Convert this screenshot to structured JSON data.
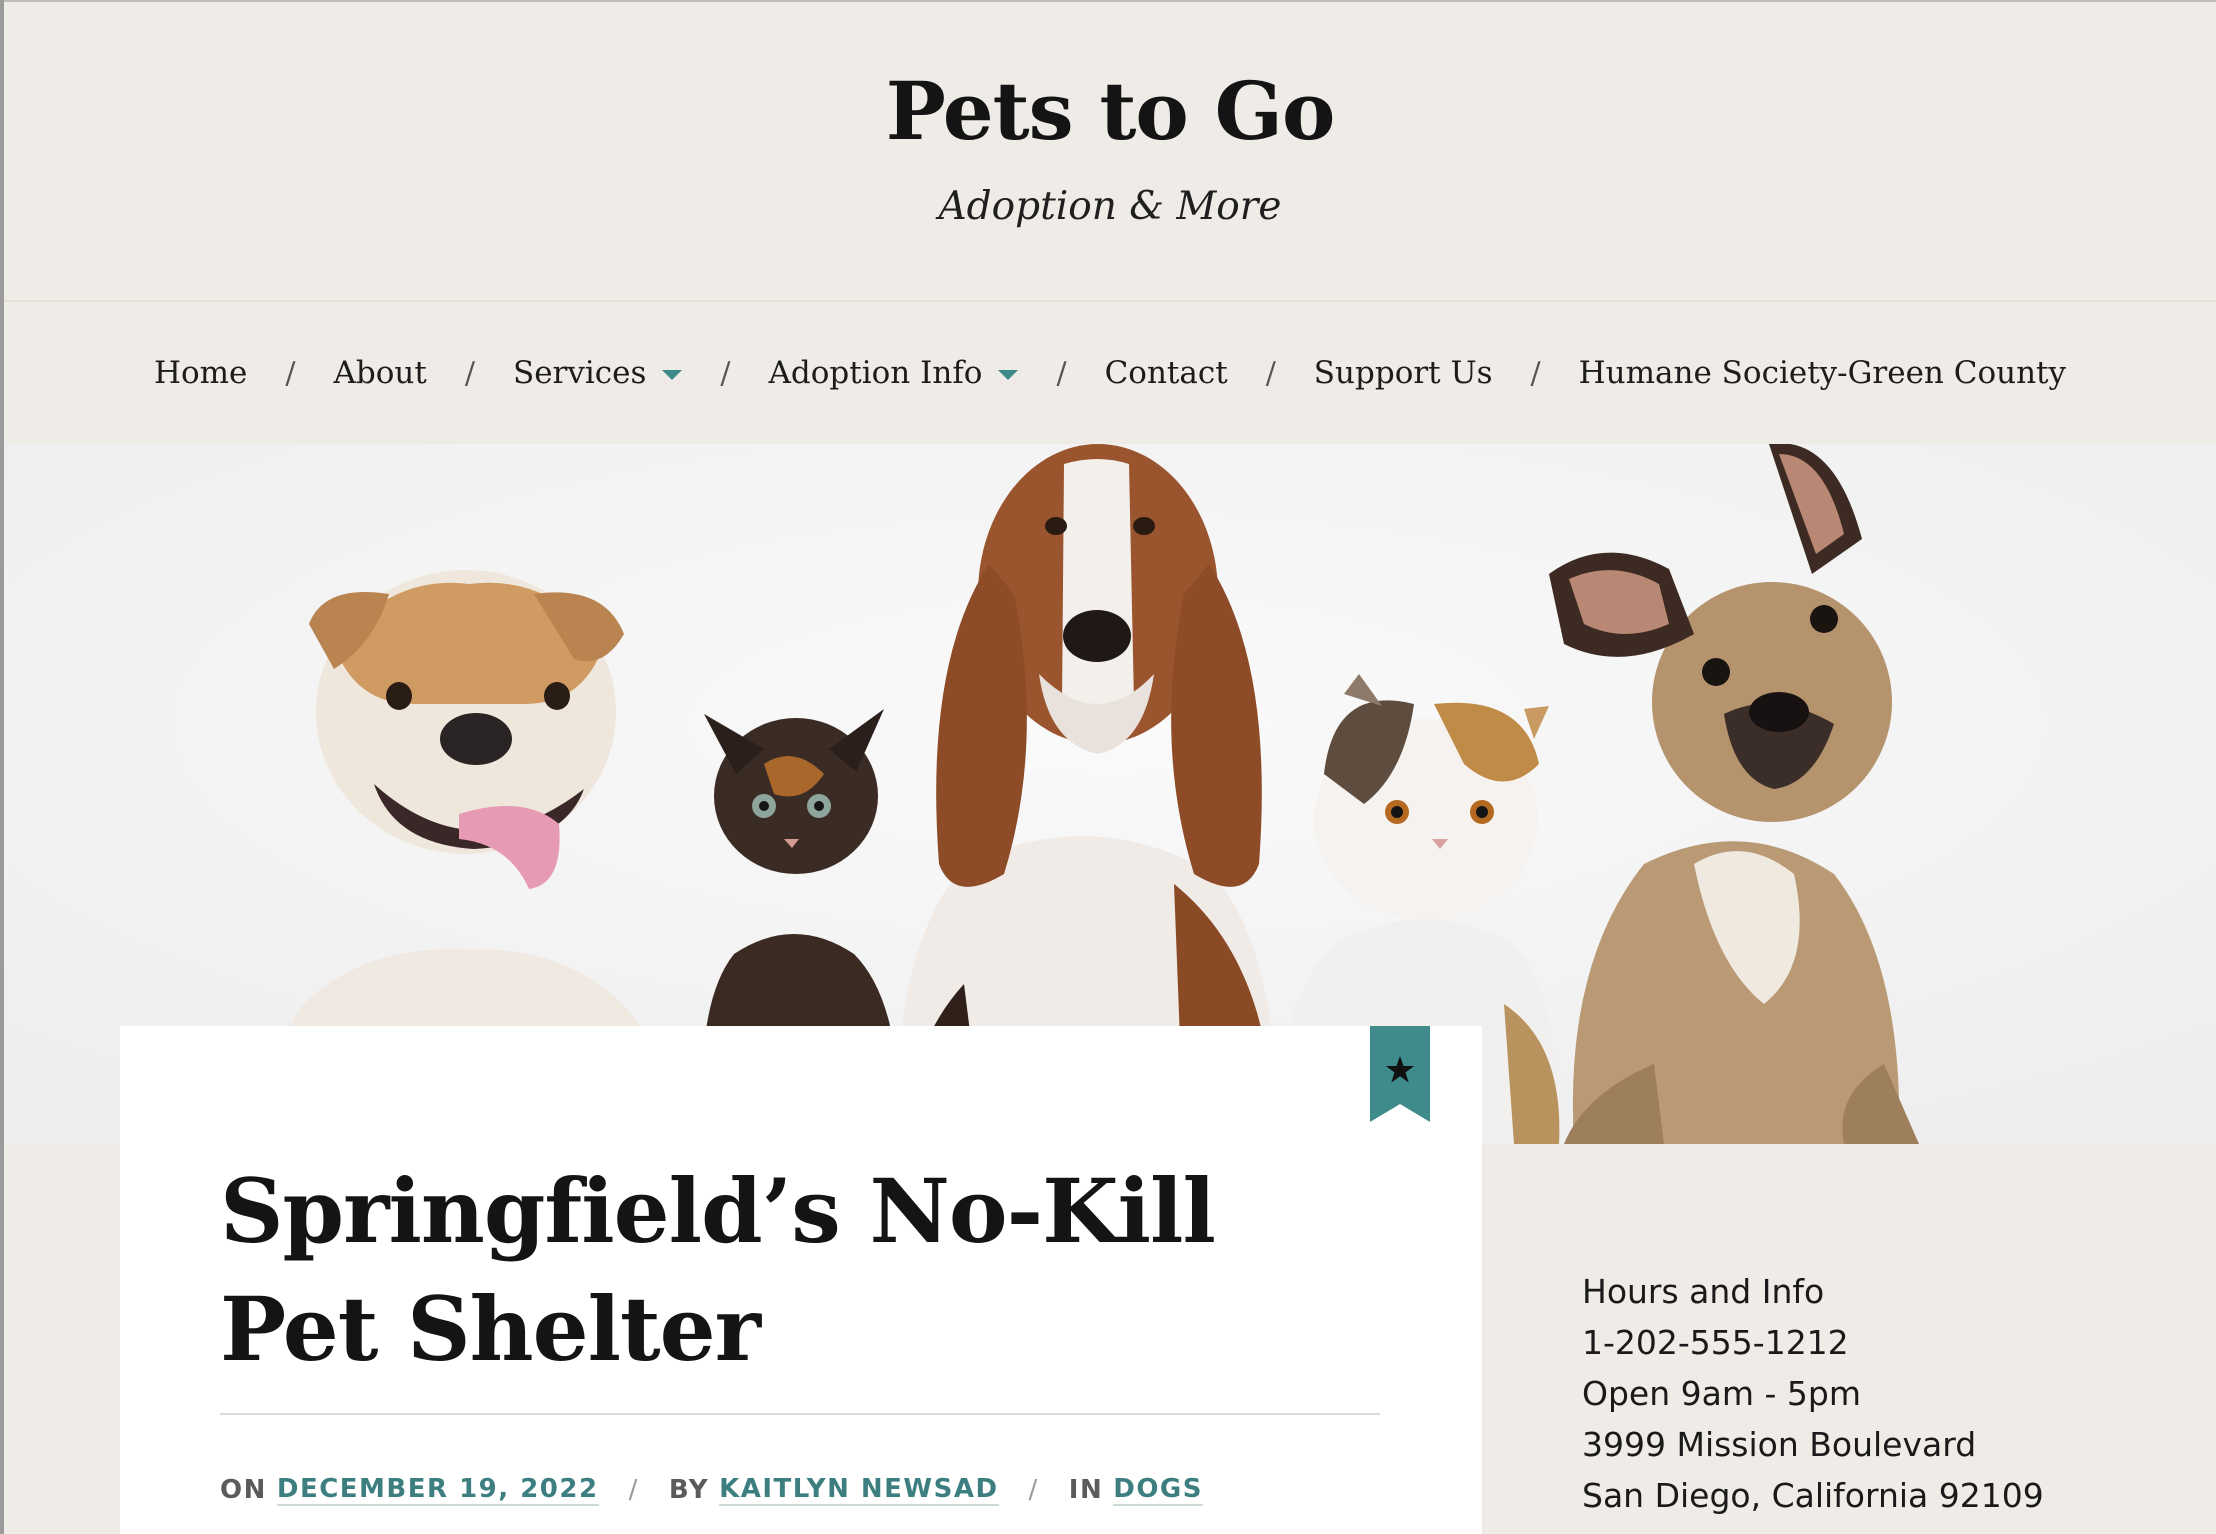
{
  "site": {
    "title": "Pets to Go",
    "tagline": "Adoption & More"
  },
  "nav": {
    "items": [
      {
        "label": "Home",
        "has_dropdown": false
      },
      {
        "label": "About",
        "has_dropdown": false
      },
      {
        "label": "Services",
        "has_dropdown": true
      },
      {
        "label": "Adoption Info",
        "has_dropdown": true
      },
      {
        "label": "Contact",
        "has_dropdown": false
      },
      {
        "label": "Support Us",
        "has_dropdown": false
      },
      {
        "label": "Humane Society-Green County",
        "has_dropdown": false
      }
    ],
    "separator": "/"
  },
  "hero": {
    "image_icon": "pets-group-photo",
    "subjects": [
      "english-bulldog",
      "tortoiseshell-kitten",
      "basset-hound",
      "calico-persian-cat",
      "french-bulldog"
    ]
  },
  "post": {
    "featured_icon": "star-icon",
    "title_line1": "Springfield’s No-Kill",
    "title_line2": "Pet Shelter",
    "meta": {
      "on_prefix": "ON",
      "date": "DECEMBER 19, 2022",
      "by_prefix": "BY",
      "author": "KAITLYN NEWSAD",
      "in_prefix": "IN",
      "category": "DOGS",
      "separator": "/"
    }
  },
  "sidebar": {
    "lines": [
      "Hours and Info",
      "1-202-555-1212",
      "Open 9am - 5pm",
      "3999 Mission Boulevard",
      "San Diego, California 92109"
    ]
  },
  "colors": {
    "background": "#efebe6",
    "accent": "#3f8a8a",
    "text": "#141414",
    "card": "#ffffff"
  }
}
